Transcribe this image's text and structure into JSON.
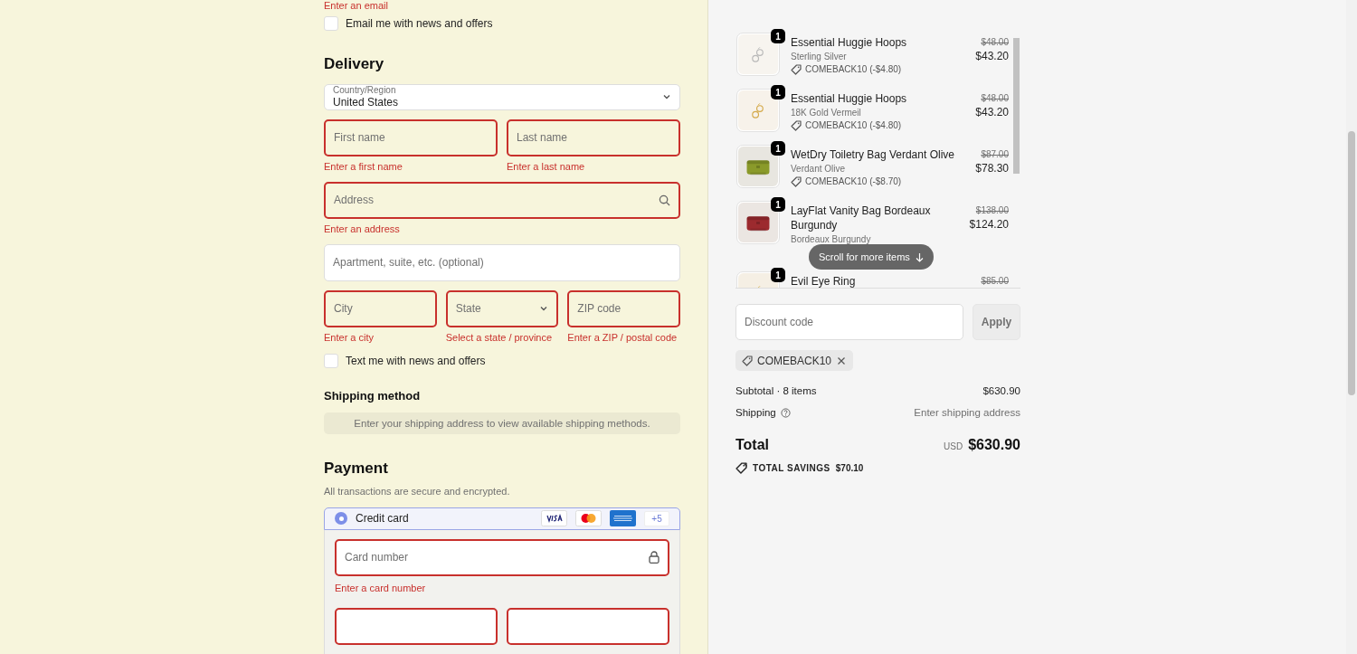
{
  "contact": {
    "email_error": "Enter an email",
    "email_opt_in": {
      "label": "Email me with news and offers",
      "checked": false
    }
  },
  "delivery": {
    "heading": "Delivery",
    "country": {
      "label": "Country/Region",
      "value": "United States"
    },
    "rows": [
      [
        {
          "kind": "input",
          "placeholder": "First name",
          "error": "Enter a first name"
        },
        {
          "kind": "input",
          "placeholder": "Last name",
          "error": "Enter a last name"
        }
      ],
      [
        {
          "kind": "search",
          "placeholder": "Address",
          "error": "Enter an address"
        }
      ],
      [
        {
          "kind": "input",
          "placeholder": "Apartment, suite, etc. (optional)"
        }
      ],
      [
        {
          "kind": "input",
          "placeholder": "City",
          "error": "Enter a city"
        },
        {
          "kind": "select",
          "placeholder": "State",
          "error": "Select a state / province"
        },
        {
          "kind": "input",
          "placeholder": "ZIP code",
          "error": "Enter a ZIP / postal code"
        }
      ]
    ],
    "sms_opt_in": {
      "label": "Text me with news and offers",
      "checked": false
    }
  },
  "shipping_method": {
    "heading": "Shipping method",
    "notice": "Enter your shipping address to view available shipping methods."
  },
  "payment": {
    "heading": "Payment",
    "subtitle": "All transactions are secure and encrypted.",
    "method": {
      "label": "Credit card",
      "selected": true,
      "more_cards": "+5"
    },
    "card_number": {
      "placeholder": "Card number",
      "error": "Enter a card number"
    }
  },
  "order_items": [
    {
      "quantity": "1",
      "name": "Essential Huggie Hoops",
      "variant": "Sterling Silver",
      "discount": "COMEBACK10 (-$4.80)",
      "original_price": "$48.00",
      "price": "$43.20"
    },
    {
      "quantity": "1",
      "name": "Essential Huggie Hoops",
      "variant": "18K Gold Vermeil",
      "discount": "COMEBACK10 (-$4.80)",
      "original_price": "$48.00",
      "price": "$43.20"
    },
    {
      "quantity": "1",
      "name": "WetDry Toiletry Bag Verdant Olive",
      "variant": "Verdant Olive",
      "discount": "COMEBACK10 (-$8.70)",
      "original_price": "$87.00",
      "price": "$78.30"
    },
    {
      "quantity": "1",
      "name": "LayFlat Vanity Bag Bordeaux Burgundy",
      "variant": "Bordeaux Burgundy",
      "original_price": "$138.00",
      "price": "$124.20"
    },
    {
      "quantity": "1",
      "name": "Evil Eye Ring",
      "original_price": "$85.00"
    }
  ],
  "scroll_hint": "Scroll for more items",
  "discount": {
    "placeholder": "Discount code",
    "button": "Apply",
    "applied_code": "COMEBACK10"
  },
  "summary": {
    "subtotal_label": "Subtotal · 8 items",
    "subtotal": "$630.90",
    "shipping_label": "Shipping",
    "shipping": "Enter shipping address",
    "total_label": "Total",
    "currency": "USD",
    "total": "$630.90",
    "savings_label": "TOTAL SAVINGS",
    "savings": "$70.10"
  }
}
